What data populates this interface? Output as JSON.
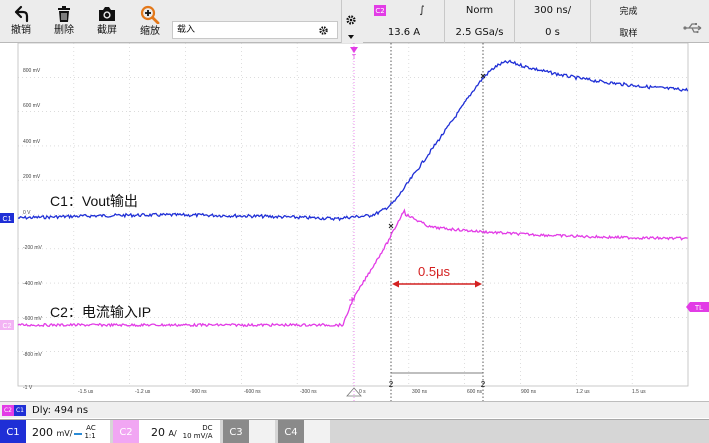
{
  "toolbar": {
    "undo_label": "撤销",
    "delete_label": "删除",
    "screenshot_label": "截屏",
    "zoom_label": "缩放",
    "load_field_value": "载入"
  },
  "trigger": {
    "channel": "C2",
    "edge_symbol": "∫",
    "level": "13.6 A",
    "mode": "Norm",
    "sample_rate": "2.5 GSa/s"
  },
  "timebase": {
    "time_per_div": "300 ns/",
    "delay": "0 s"
  },
  "acquisition": {
    "status": "完成",
    "mode": "取样"
  },
  "plot": {
    "y_ticks": [
      "800 mV",
      "600 mV",
      "400 mV",
      "200 mV",
      "0 V",
      "-200 mV",
      "-400 mV",
      "-600 mV",
      "-800 mV",
      "-1 V"
    ],
    "x_ticks": [
      "-1.5 us",
      "-1.2 us",
      "-900 ns",
      "-600 ns",
      "-300 ns",
      "0 s",
      "300 ns",
      "600 ns",
      "900 ns",
      "1.2 us",
      "1.5 us"
    ],
    "ch1_marker": "C1",
    "ch2_marker": "C2",
    "trigger_level_marker": "TL",
    "trigger_pos_marker": "T",
    "cursor_marker_1": "2",
    "cursor_marker_2": "2",
    "label_c1": "C1：Vout输出",
    "label_c2": "C2：电流输入IP",
    "measure_label": "0.5μs",
    "colors": {
      "ch1": "#1f2fd6",
      "ch2": "#e23ce6",
      "measure": "#d42020",
      "grid": "#9a9a9a"
    }
  },
  "delay_bar": {
    "chip_a": "C2",
    "chip_b": "C1",
    "text": "Dly: 494 ns"
  },
  "channels": {
    "c1": {
      "tag": "C1",
      "scale": "200",
      "unit": "mV/",
      "coupling": "AC",
      "ratio": "1:1"
    },
    "c2": {
      "tag": "C2",
      "scale": "20",
      "unit": "A/",
      "coupling": "DC",
      "ratio": "10 mV/A"
    },
    "c3": {
      "tag": "C3"
    },
    "c4": {
      "tag": "C4"
    }
  }
}
